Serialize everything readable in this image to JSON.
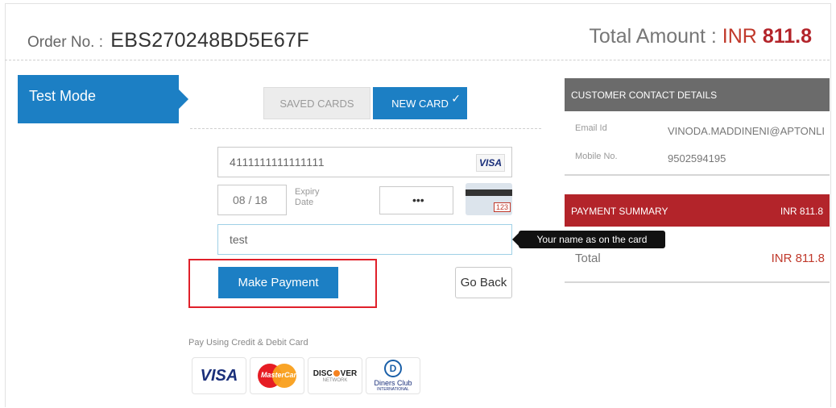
{
  "header": {
    "order_label": "Order No. :",
    "order_no": "EBS270248BD5E67F",
    "total_label": "Total Amount :",
    "currency": "INR",
    "total_amount": "811.8"
  },
  "mode": {
    "label": "Test Mode"
  },
  "tabs": {
    "saved": "SAVED CARDS",
    "new": "NEW CARD",
    "new_check": "✓"
  },
  "form": {
    "card_number": "4111111111111111",
    "card_brand": "VISA",
    "expiry_value": "08 / 18",
    "expiry_label_1": "Expiry",
    "expiry_label_2": "Date",
    "cvv_value": "•••",
    "cvv_sample": "123",
    "name_value": "test",
    "name_tooltip": "Your name as on the card"
  },
  "buttons": {
    "make_payment": "Make Payment",
    "go_back": "Go Back"
  },
  "payment_methods": {
    "caption": "Pay Using Credit & Debit Card",
    "visa": "VISA",
    "mastercard": "MasterCard",
    "discover_pre": "DISC",
    "discover_post": "VER",
    "discover_sub": "NETWORK",
    "diners_mark": "D",
    "diners_1": "Diners Club",
    "diners_2": "INTERNATIONAL"
  },
  "customer": {
    "title": "CUSTOMER CONTACT DETAILS",
    "email_label": "Email Id",
    "email_value": "VINODA.MADDINENI@APTONLINE",
    "mobile_label": "Mobile No.",
    "mobile_value": "9502594195"
  },
  "summary": {
    "title": "PAYMENT SUMMARY",
    "amount": "INR 811.8",
    "total_label": "Total",
    "total_value": "INR 811.8"
  },
  "colors": {
    "primary_blue": "#1c7fc4",
    "summary_red": "#b3242a",
    "highlight_red": "#e0202a",
    "contact_grey": "#6b6b6b"
  }
}
